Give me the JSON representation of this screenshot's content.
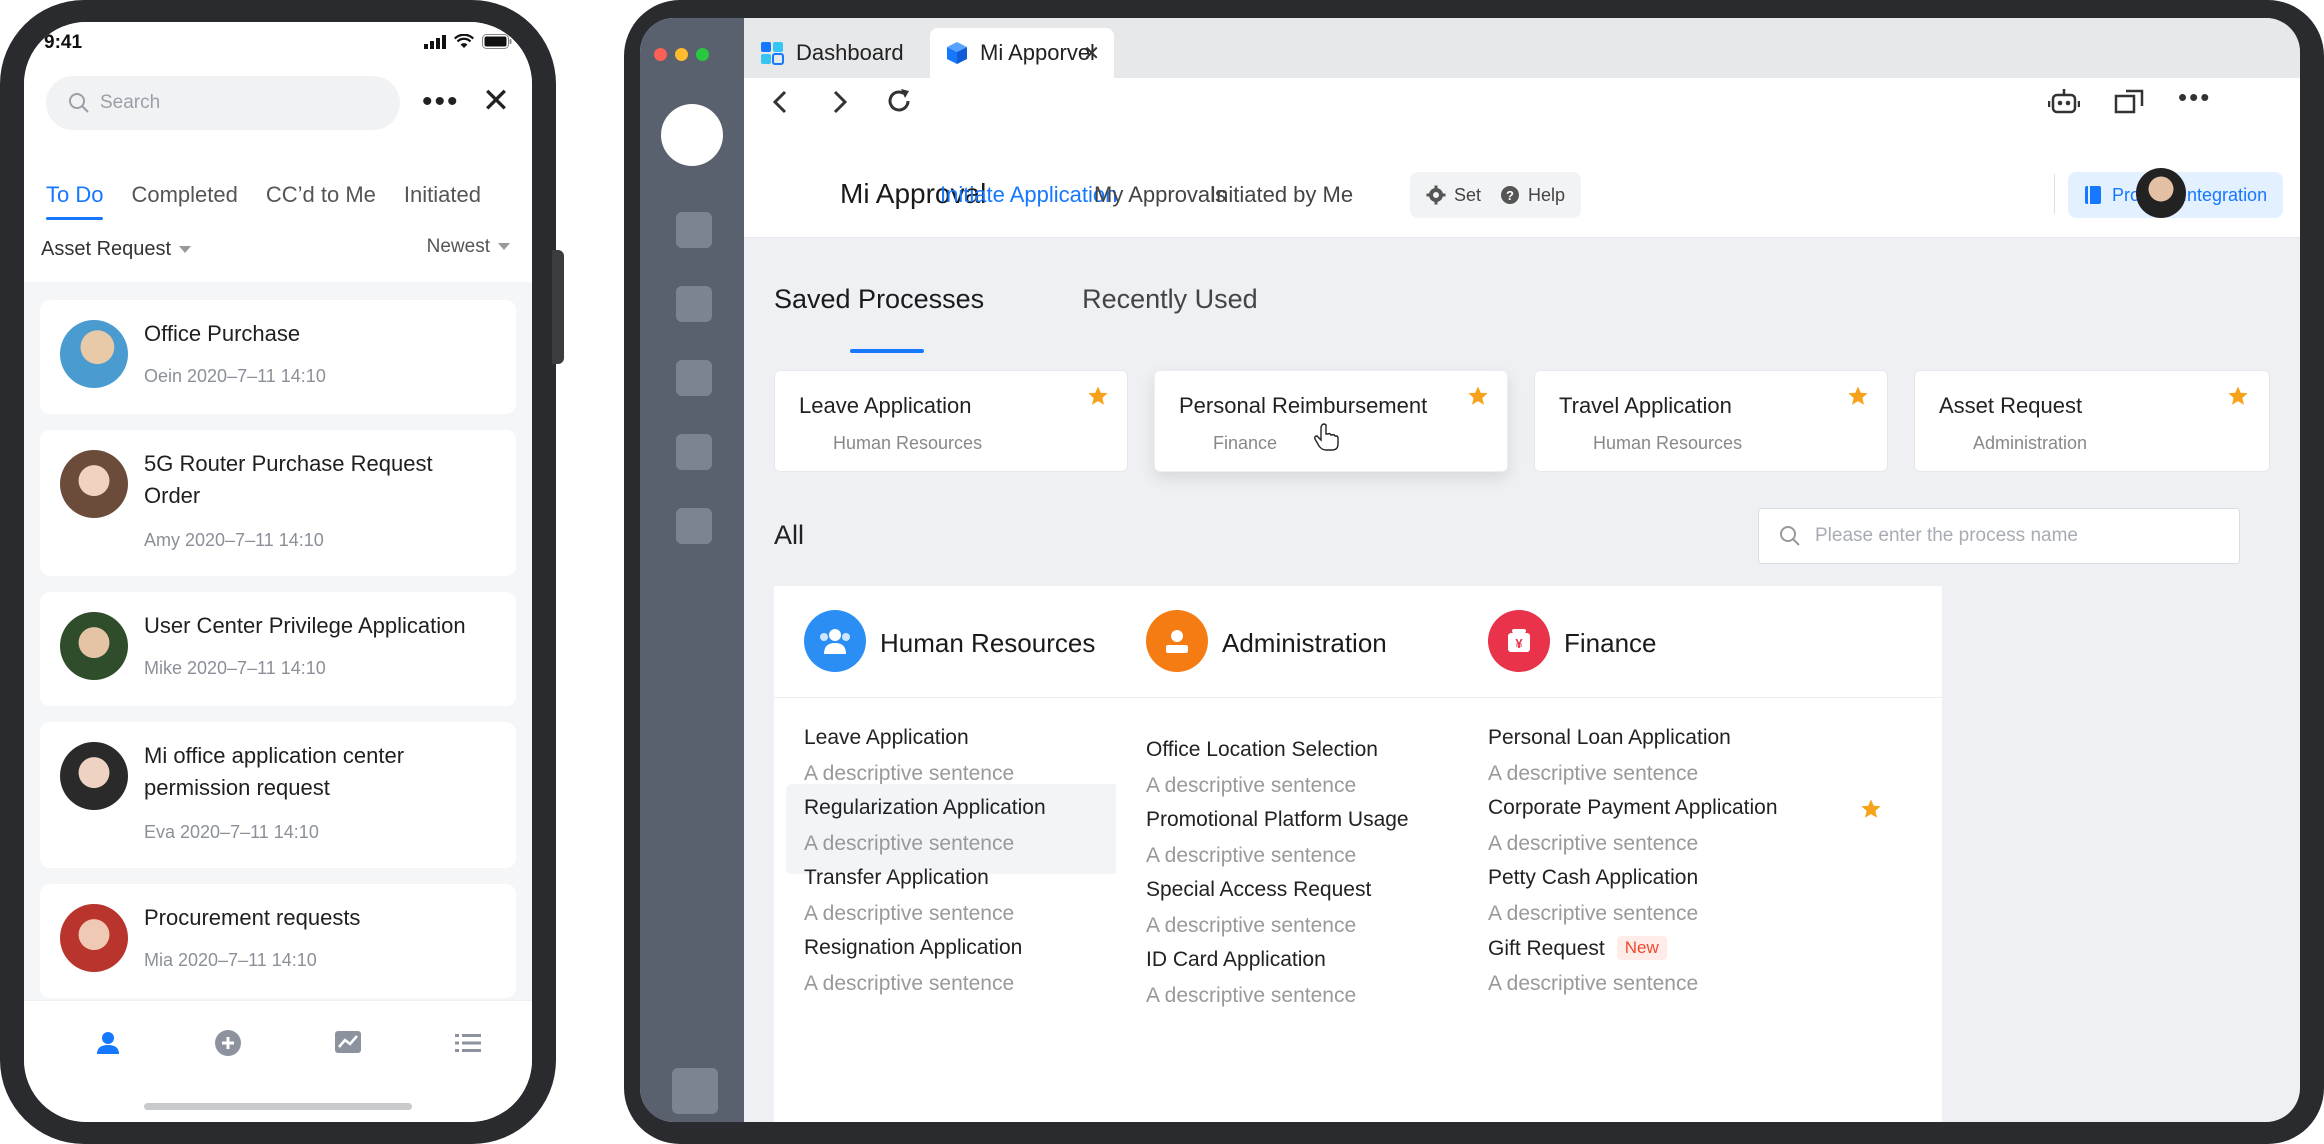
{
  "phone": {
    "time": "9:41",
    "search_placeholder": "Search",
    "tabs": [
      "To Do",
      "Completed",
      "CC’d to Me",
      "Initiated"
    ],
    "filter": "Asset Request",
    "sort": "Newest",
    "items": [
      {
        "title": "Office Purchase",
        "meta": "Oein  2020–7–11 14:10"
      },
      {
        "title": "5G Router Purchase Request Order",
        "meta": "Amy 2020–7–11 14:10"
      },
      {
        "title": "User Center Privilege Application",
        "meta": "Mike  2020–7–11 14:10"
      },
      {
        "title": "Mi office application center permission request",
        "meta": "Eva  2020–7–11 14:10"
      },
      {
        "title": "Procurement requests",
        "meta": "Mia  2020–7–11 14:10"
      }
    ],
    "nav": [
      "person-icon",
      "add-circle-icon",
      "chart-icon",
      "list-icon"
    ]
  },
  "tablet": {
    "tabs": [
      "Dashboard",
      "Mi Apporvel"
    ],
    "app_title": "Mi Approval",
    "nav": [
      "Initiate Application",
      "My Approvals",
      "Initiated by Me"
    ],
    "set": "Set",
    "help": "Help",
    "process_integration": "Process Integration",
    "section_tabs": [
      "Saved Processes",
      "Recently Used"
    ],
    "saved": [
      {
        "title": "Leave Application",
        "sub": "Human Resources"
      },
      {
        "title": "Personal Reimbursement",
        "sub": "Finance"
      },
      {
        "title": "Travel Application",
        "sub": "Human Resources"
      },
      {
        "title": "Asset Request",
        "sub": "Administration"
      }
    ],
    "all_label": "All",
    "search_placeholder": "Please enter the process name",
    "columns": [
      {
        "title": "Human Resources",
        "items": [
          {
            "title": "Leave Application",
            "desc": "A descriptive sentence"
          },
          {
            "title": "Regularization Application",
            "desc": "A descriptive sentence"
          },
          {
            "title": "Transfer Application",
            "desc": "A descriptive sentence"
          },
          {
            "title": "Resignation Application",
            "desc": "A descriptive sentence"
          }
        ]
      },
      {
        "title": "Administration",
        "items": [
          {
            "title": "Office Location Selection",
            "desc": "A descriptive sentence"
          },
          {
            "title": "Promotional Platform Usage",
            "desc": "A descriptive sentence"
          },
          {
            "title": "Special Access Request",
            "desc": "A descriptive sentence"
          },
          {
            "title": "ID Card Application",
            "desc": "A descriptive sentence"
          }
        ]
      },
      {
        "title": "Finance",
        "items": [
          {
            "title": "Personal Loan Application",
            "desc": "A descriptive sentence"
          },
          {
            "title": "Corporate Payment Application",
            "desc": "A descriptive sentence"
          },
          {
            "title": "Petty Cash Application",
            "desc": "A descriptive sentence"
          },
          {
            "title": "Gift Request",
            "desc": "A descriptive sentence",
            "badge": "New"
          }
        ]
      }
    ]
  },
  "colors": {
    "accent": "#1677ff",
    "star": "#f7a21b",
    "hr": "#2b8ef5",
    "admin": "#f57c12",
    "finance": "#e8334a",
    "badge": "#f04a2e"
  }
}
